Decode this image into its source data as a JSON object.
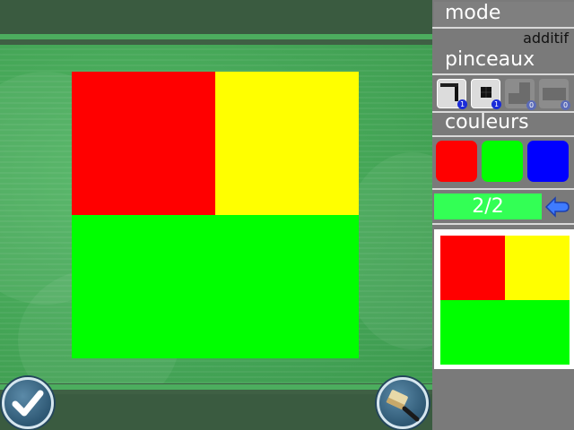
{
  "panel": {
    "mode_title": "mode",
    "mode_value": "additif",
    "brushes_title": "pinceaux",
    "colors_title": "couleurs",
    "progress": "2/2"
  },
  "brushes": [
    {
      "icon": "brush-large-icon",
      "badge": "1",
      "active": true
    },
    {
      "icon": "brush-small-icon",
      "badge": "1",
      "active": true
    },
    {
      "icon": "brush-locked-icon",
      "badge": "0",
      "active": false
    },
    {
      "icon": "brush-locked-icon",
      "badge": "0",
      "active": false
    }
  ],
  "colors": [
    {
      "name": "red",
      "hex": "#ff0000"
    },
    {
      "name": "green",
      "hex": "#00ff00"
    },
    {
      "name": "blue",
      "hex": "#0000ff"
    }
  ],
  "canvas": {
    "grid": 2,
    "cells": [
      {
        "row": 0,
        "col": 0,
        "color": "#ff0000"
      },
      {
        "row": 0,
        "col": 1,
        "color": "#ffff00"
      },
      {
        "row": 1,
        "col": 0,
        "color": "#00ff00"
      },
      {
        "row": 1,
        "col": 1,
        "color": "#00ff00"
      }
    ]
  },
  "target": {
    "grid": 2,
    "cells": [
      {
        "row": 0,
        "col": 0,
        "color": "#ff0000"
      },
      {
        "row": 0,
        "col": 1,
        "color": "#ffff00"
      },
      {
        "row": 1,
        "col": 0,
        "color": "#00ff00"
      },
      {
        "row": 1,
        "col": 1,
        "color": "#00ff00"
      }
    ]
  },
  "buttons": {
    "validate_icon": "checkmark-icon",
    "clear_icon": "brush-eraser-icon",
    "back_icon": "back-arrow-icon"
  }
}
